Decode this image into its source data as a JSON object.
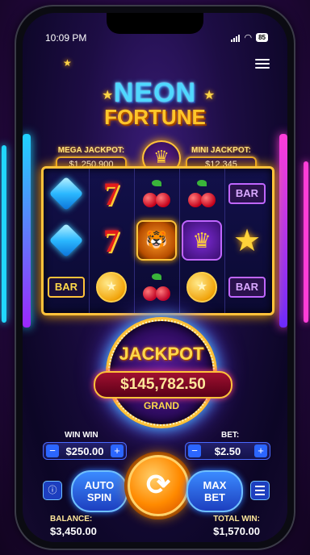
{
  "status_bar": {
    "time": "10:09 PM",
    "battery": "85"
  },
  "game": {
    "title_line1": "NEON",
    "title_line2": "FORTUNE"
  },
  "jackpots": {
    "mega": {
      "label": "MEGA JACKPOT:",
      "value": "$1,250,900"
    },
    "mini": {
      "label": "MINI JACKPOT:",
      "value": "$12,345"
    }
  },
  "reels": [
    [
      "diamond",
      "diamond",
      "bar-gold"
    ],
    [
      "seven",
      "seven",
      "coin"
    ],
    [
      "cherry",
      "tiger",
      "cherry"
    ],
    [
      "cherry",
      "crown",
      "coin"
    ],
    [
      "bar-purple",
      "star",
      "bar-purple"
    ]
  ],
  "symbol_text": {
    "bar": "BAR",
    "seven": "7"
  },
  "grand_jackpot": {
    "title": "JACKPOT",
    "value": "$145,782.50",
    "tier": "GRAND"
  },
  "controls": {
    "win_label": "WIN WIN",
    "win_value": "$250.00",
    "bet_label": "BET:",
    "bet_value": "$2.50",
    "minus": "−",
    "plus": "+",
    "autospin_line1": "AUTO",
    "autospin_line2": "SPIN",
    "maxbet_line1": "MAX",
    "maxbet_line2": "BET",
    "info_icon": "ⓘ"
  },
  "footer": {
    "balance_label": "BALANCE:",
    "balance_value": "$3,450.00",
    "total_win_label": "TOTAL WIN:",
    "total_win_value": "$1,570.00"
  },
  "colors": {
    "accent_gold": "#ffc23a",
    "accent_cyan": "#4fd8ff",
    "spin_orange": "#ff8a00",
    "button_blue": "#2b66ff"
  }
}
